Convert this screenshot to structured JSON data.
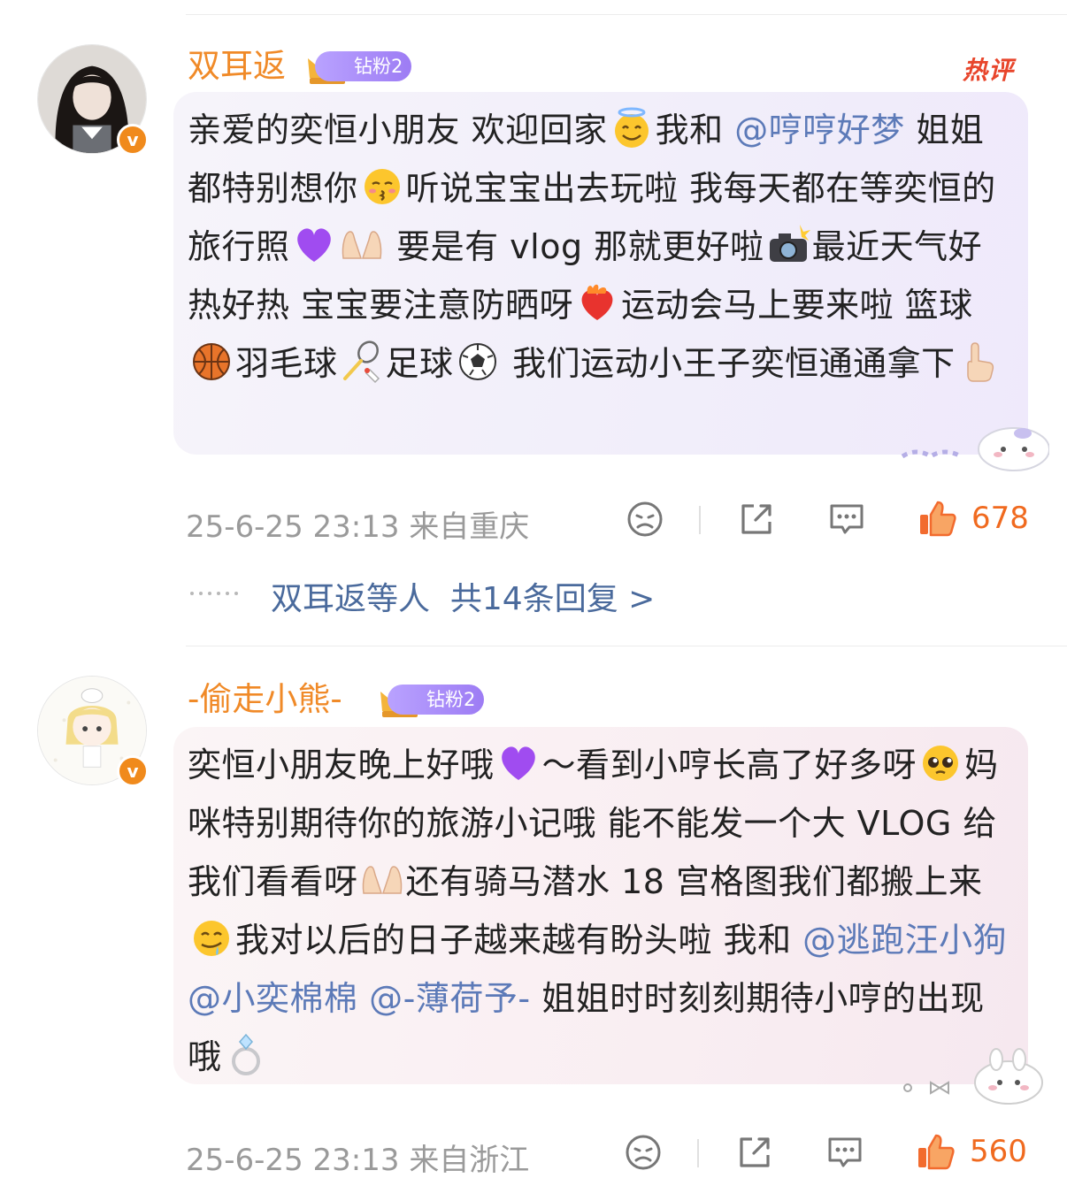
{
  "comments": [
    {
      "username": "双耳返",
      "badge": "钻粉2",
      "hot_label": "热评",
      "avatar_icon": "girl-portrait-avatar",
      "verified_icon": "verified-v-icon",
      "content": [
        {
          "t": "text",
          "v": "亲爱的奕恒小朋友 欢迎回家"
        },
        {
          "t": "emoji",
          "v": "halo-smile-emoji"
        },
        {
          "t": "text",
          "v": "我和 "
        },
        {
          "t": "mention",
          "v": "@哼哼好梦"
        },
        {
          "t": "text",
          "v": " 姐姐都特别想你"
        },
        {
          "t": "emoji",
          "v": "kiss-emoji"
        },
        {
          "t": "text",
          "v": "听说宝宝出去玩啦 我每天都在等奕恒的旅行照"
        },
        {
          "t": "emoji",
          "v": "purple-heart-emoji"
        },
        {
          "t": "emoji",
          "v": "palms-up-emoji"
        },
        {
          "t": "text",
          "v": " 要是有 vlog 那就更好啦"
        },
        {
          "t": "emoji",
          "v": "camera-flash-emoji"
        },
        {
          "t": "text",
          "v": "最近天气好热好热 宝宝要注意防晒呀"
        },
        {
          "t": "emoji",
          "v": "heart-on-fire-emoji"
        },
        {
          "t": "text",
          "v": "运动会马上要来啦 篮球"
        },
        {
          "t": "emoji",
          "v": "basketball-emoji"
        },
        {
          "t": "text",
          "v": "羽毛球"
        },
        {
          "t": "emoji",
          "v": "badminton-emoji"
        },
        {
          "t": "text",
          "v": "足球"
        },
        {
          "t": "emoji",
          "v": "soccer-emoji"
        },
        {
          "t": "text",
          "v": " 我们运动小王子奕恒通通拿下"
        },
        {
          "t": "emoji",
          "v": "index-up-emoji"
        }
      ],
      "time": "25-6-25 23:13",
      "location": "来自重庆",
      "likes": "678",
      "replies": {
        "names": "双耳返等人",
        "count_text": "共14条回复 >"
      }
    },
    {
      "username": "-偷走小熊-",
      "badge": "钻粉2",
      "avatar_icon": "anime-girl-avatar",
      "verified_icon": "verified-v-icon",
      "content": [
        {
          "t": "text",
          "v": "奕恒小朋友晚上好哦"
        },
        {
          "t": "emoji",
          "v": "purple-heart-emoji"
        },
        {
          "t": "text",
          "v": "～看到小哼长高了好多呀"
        },
        {
          "t": "emoji",
          "v": "pleading-face-emoji"
        },
        {
          "t": "text",
          "v": "妈咪特别期待你的旅游小记哦 能不能发一个大 VLOG 给我们看看呀"
        },
        {
          "t": "emoji",
          "v": "palms-up-emoji"
        },
        {
          "t": "text",
          "v": "还有骑马潜水 18 宫格图我们都搬上来"
        },
        {
          "t": "emoji",
          "v": "drooling-face-emoji"
        },
        {
          "t": "text",
          "v": "我对以后的日子越来越有盼头啦 我和 "
        },
        {
          "t": "mention",
          "v": "@逃跑汪小狗"
        },
        {
          "t": "text",
          "v": " "
        },
        {
          "t": "mention",
          "v": "@小奕棉棉"
        },
        {
          "t": "text",
          "v": " "
        },
        {
          "t": "mention",
          "v": "@-薄荷予-"
        },
        {
          "t": "text",
          "v": " 姐姐时时刻刻期待小哼的出现哦"
        },
        {
          "t": "emoji",
          "v": "ring-emoji"
        }
      ],
      "time": "25-6-25 23:13",
      "location": "来自浙江",
      "likes": "560"
    }
  ],
  "action_icons": [
    "dislike-face-icon",
    "share-icon",
    "comment-icon",
    "like-thumb-icon"
  ],
  "colors": {
    "username": "#f08a28",
    "mention": "#5c7ab8",
    "like": "#f06a1f",
    "hot": "#e8452b",
    "badge": "#a98bf7"
  }
}
